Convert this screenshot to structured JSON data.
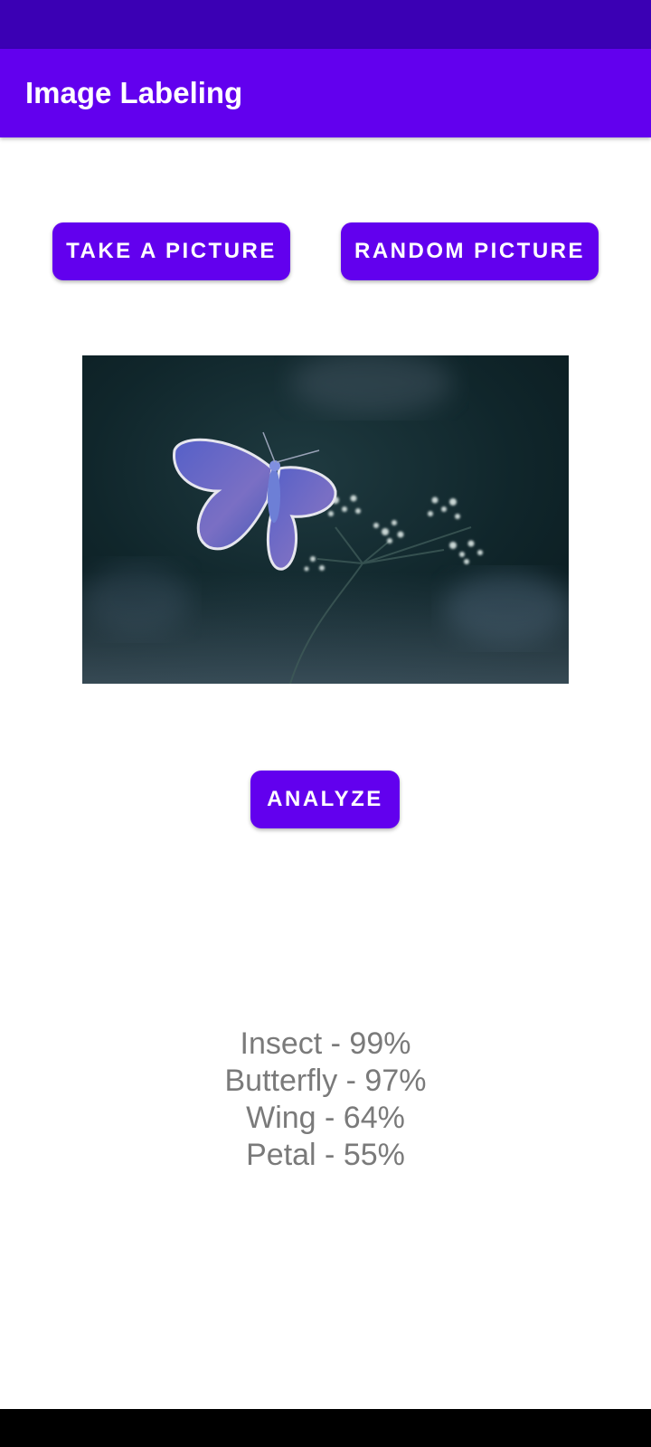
{
  "app_bar": {
    "title": "Image Labeling"
  },
  "buttons": {
    "take_picture": "TAKE A PICTURE",
    "random_picture": "RANDOM PICTURE",
    "analyze": "ANALYZE"
  },
  "photo": {
    "subject": "butterfly-on-flower"
  },
  "results": [
    {
      "text": "Insect - 99%"
    },
    {
      "text": "Butterfly - 97%"
    },
    {
      "text": "Wing - 64%"
    },
    {
      "text": "Petal - 55%"
    }
  ],
  "colors": {
    "primary": "#6200ee",
    "primary_dark": "#3b00b4",
    "result_text": "#7a7a7a"
  }
}
